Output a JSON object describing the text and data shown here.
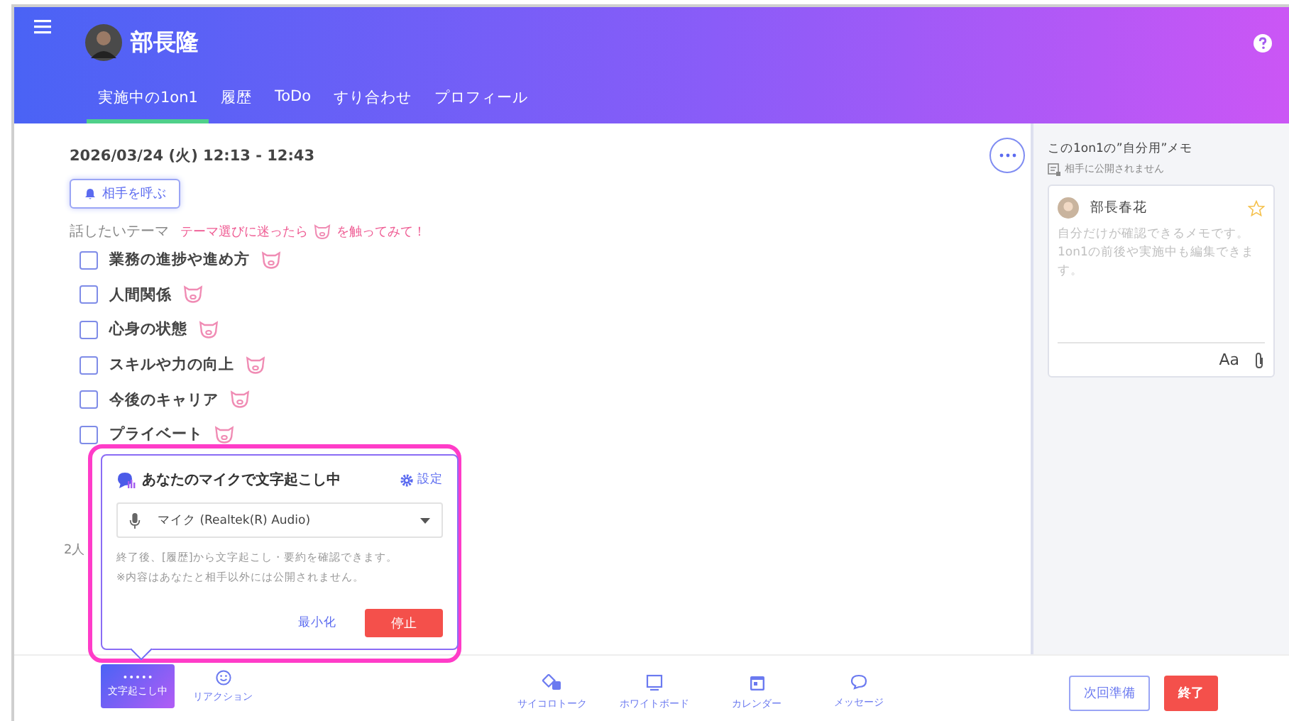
{
  "header": {
    "name": "部長隆"
  },
  "tabs": [
    {
      "label": "実施中の1on1",
      "selected": true
    },
    {
      "label": "履歴",
      "selected": false
    },
    {
      "label": "ToDo",
      "selected": false
    },
    {
      "label": "すり合わせ",
      "selected": false
    },
    {
      "label": "プロフィール",
      "selected": false
    }
  ],
  "session": {
    "datetime": "2026/03/24 (火) 12:13 - 12:43",
    "call_button": "相手を呼ぶ"
  },
  "topics": {
    "label": "話したいテーマ",
    "hint_before": "テーマ選びに迷ったら",
    "hint_after": "を触ってみて！",
    "items": [
      {
        "label": "業務の進捗や進め方",
        "checked": false
      },
      {
        "label": "人間関係",
        "checked": false
      },
      {
        "label": "心身の状態",
        "checked": false
      },
      {
        "label": "スキルや力の向上",
        "checked": false
      },
      {
        "label": "今後のキャリア",
        "checked": false
      },
      {
        "label": "プライベート",
        "checked": false
      }
    ]
  },
  "second_section_label": "2人",
  "memo": {
    "title": "この1on1の”自分用”メモ",
    "note": "相手に公開されません",
    "author": "部長春花",
    "starred": false,
    "placeholder": "自分だけが確認できるメモです。1on1の前後や実施中も編集できます。",
    "format_button": "Aa"
  },
  "transcription_popup": {
    "title": "あなたのマイクで文字起こし中",
    "settings": "設定",
    "device": "マイク (Realtek(R) Audio)",
    "info": [
      "終了後、[履歴]から文字起こし・要約を確認できます。",
      "※内容はあなたと相手以外には公開されません。"
    ],
    "minimize": "最小化",
    "stop": "停止"
  },
  "toolbar": [
    {
      "kind": "transcribe",
      "label": "文字起こし中",
      "selected": true
    },
    {
      "kind": "reaction",
      "label": "リアクション",
      "selected": false
    }
  ],
  "tools": [
    {
      "kind": "dice",
      "label": "サイコロトーク"
    },
    {
      "kind": "whiteboard",
      "label": "ホワイトボード"
    },
    {
      "kind": "calendar",
      "label": "カレンダー"
    },
    {
      "kind": "message",
      "label": "メッセージ"
    }
  ],
  "footer_buttons": {
    "prepare": "次回準備",
    "end": "終了"
  }
}
